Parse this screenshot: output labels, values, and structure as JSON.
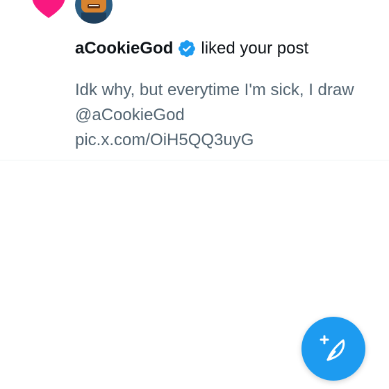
{
  "notification": {
    "username": "aCookieGod",
    "action": "liked your post",
    "post_lines": [
      "Idk why, but everytime I'm sick, I draw",
      "@aCookieGod",
      "pic.x.com/OiH5QQ3uyG"
    ],
    "icons": {
      "type": "heart-icon",
      "badge": "verified-badge-icon",
      "avatar": "avatar"
    }
  },
  "compose": {
    "icon": "compose-post-icon"
  },
  "colors": {
    "like_pink": "#f91880",
    "verified_blue": "#1d9bf0",
    "accent_blue": "#1d9bf0",
    "secondary_text": "#536471"
  }
}
